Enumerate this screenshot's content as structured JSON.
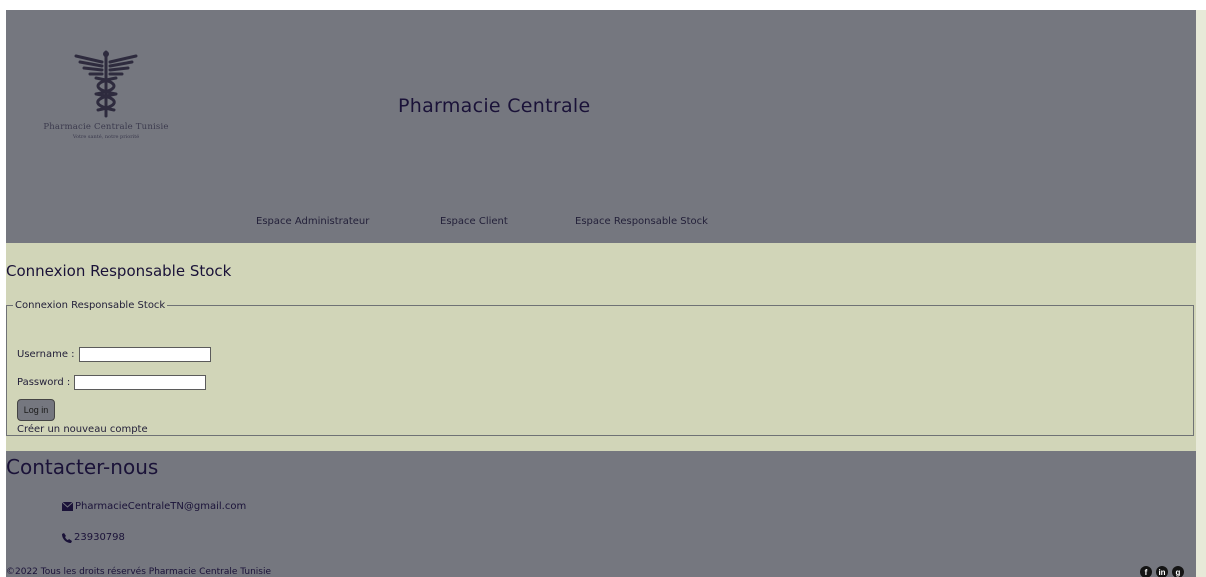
{
  "header": {
    "logo_name": "Pharmacie Centrale Tunisie",
    "logo_tagline": "Votre santé, notre priorité",
    "site_title": "Pharmacie Centrale",
    "nav": [
      {
        "label": "Espace Administrateur"
      },
      {
        "label": "Espace Client"
      },
      {
        "label": "Espace Responsable Stock"
      }
    ]
  },
  "login": {
    "title": "Connexion Responsable Stock",
    "legend": "Connexion Responsable Stock",
    "username_label": "Username :",
    "username_value": "",
    "password_label": "Password :",
    "password_value": "",
    "login_button": "Log in",
    "create_account_link": "Créer un nouveau compte"
  },
  "footer": {
    "contact_title": "Contacter-nous",
    "email": "PharmacieCentraleTN@gmail.com",
    "phone": "23930798",
    "copyright": "©2022 Tous les droits réservés Pharmacie Centrale Tunisie",
    "socials": [
      {
        "icon": "facebook-icon",
        "glyph": "f"
      },
      {
        "icon": "linkedin-icon",
        "glyph": "in"
      },
      {
        "icon": "github-icon",
        "glyph": "g"
      }
    ]
  },
  "colors": {
    "header_bg": "#75777f",
    "page_bg": "#d1d5b8",
    "title_text": "#1a1238"
  }
}
